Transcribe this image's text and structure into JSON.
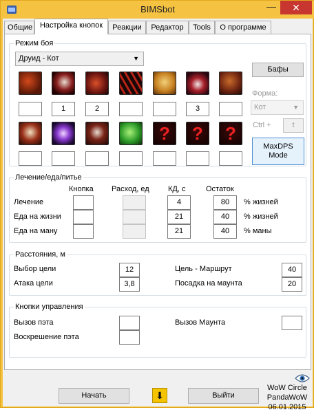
{
  "window": {
    "title": "BIMSbot",
    "minimize_glyph": "—",
    "close_glyph": "✕"
  },
  "tabs": [
    "Общие",
    "Настройка кнопок",
    "Реакции",
    "Редактор",
    "Tools",
    "О программе"
  ],
  "combat": {
    "group_title": "Режим боя",
    "mode_value": "Друид - Кот",
    "buffs_label": "Бафы",
    "form_label": "Форма:",
    "form_value": "Кот",
    "ctrl_label": "Ctrl +",
    "ctrl_key": "t",
    "maxdps_line1": "MaxDPS",
    "maxdps_line2": "Mode",
    "row1_keys": [
      "",
      "1",
      "2",
      "",
      "",
      "3",
      ""
    ],
    "row2_keys": [
      "",
      "",
      "",
      "",
      "",
      "",
      ""
    ],
    "row1_icons": [
      "bear-maul-icon",
      "claw-slash-icon",
      "rake-icon",
      "shred-icon",
      "tiger-fury-icon",
      "ferocious-bite-icon",
      "mangle-icon"
    ],
    "row2_icons": [
      "skull-roar-icon",
      "starfall-icon",
      "rip-icon",
      "leaf-heal-icon",
      "question-icon",
      "question-icon",
      "question-icon"
    ]
  },
  "heal": {
    "group_title": "Лечение/еда/питье",
    "col_key": "Кнопка",
    "col_use": "Расход, ед",
    "col_cd": "КД, с",
    "col_rest": "Остаток",
    "rows": [
      {
        "label": "Лечение",
        "key": "",
        "use": "",
        "cd": "4",
        "rest": "80",
        "unit": "% жизней"
      },
      {
        "label": "Еда на жизни",
        "key": "",
        "use": "",
        "cd": "21",
        "rest": "40",
        "unit": "% жизней"
      },
      {
        "label": "Еда на ману",
        "key": "",
        "use": "",
        "cd": "21",
        "rest": "40",
        "unit": "% маны"
      }
    ]
  },
  "dist": {
    "group_title": "Расстояния, м",
    "target_label": "Выбор цели",
    "target_value": "12",
    "attack_label": "Атака цели",
    "attack_value": "3,8",
    "route_label": "Цель - Маршрут",
    "route_value": "40",
    "mount_label": "Посадка на маунта",
    "mount_value": "20"
  },
  "controls": {
    "group_title": "Кнопки управления",
    "pet_call_label": "Вызов пэта",
    "pet_res_label": "Воскрешение пэта",
    "mount_call_label": "Вызов Маунта",
    "pet_call_key": "",
    "pet_res_key": "",
    "mount_call_key": ""
  },
  "footer": {
    "start_label": "Начать",
    "exit_label": "Выйти",
    "server_line1": "WoW Circle",
    "server_line2": "PandaWoW",
    "date": "06.01.2015",
    "down_glyph": "⬇"
  },
  "colors": {
    "accent": "#f5c242",
    "close": "#c7372f",
    "focus": "#4f8ed4"
  }
}
